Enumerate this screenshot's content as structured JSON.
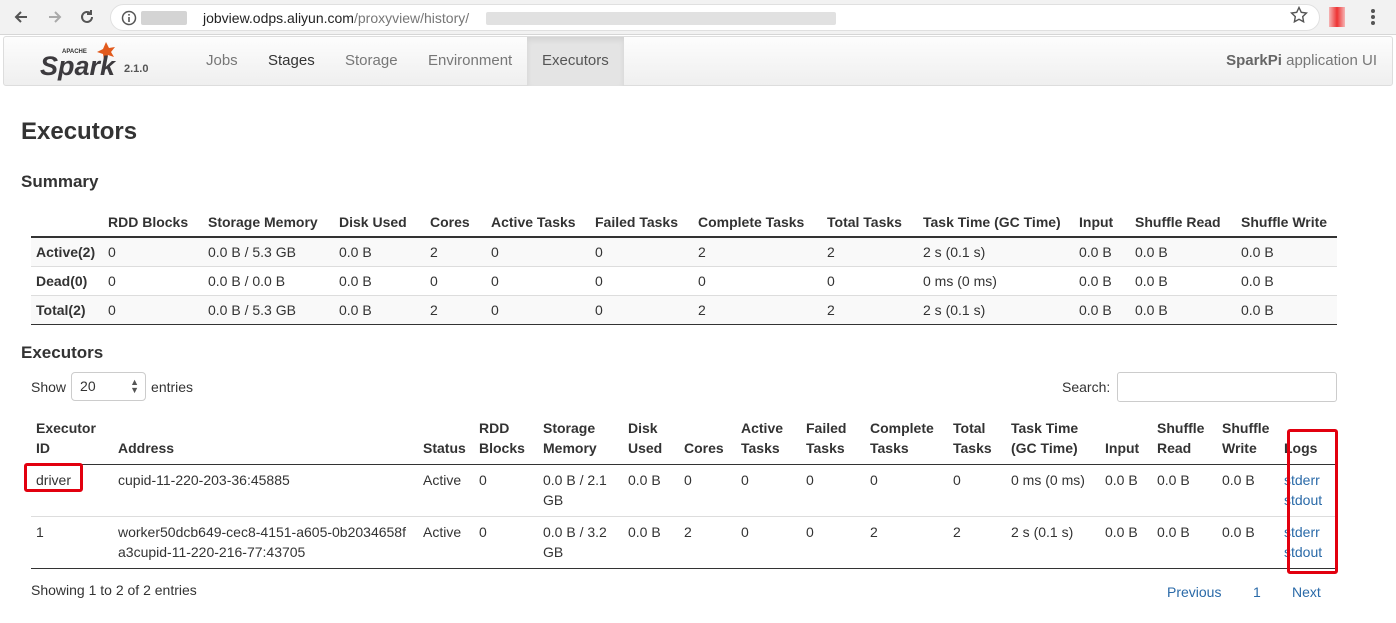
{
  "browser": {
    "url_host": "jobview.odps.aliyun.com",
    "url_path": "/proxyview/history/"
  },
  "nav": {
    "version": "2.1.0",
    "tabs": [
      {
        "label": "Jobs"
      },
      {
        "label": "Stages"
      },
      {
        "label": "Storage"
      },
      {
        "label": "Environment"
      },
      {
        "label": "Executors"
      }
    ],
    "app_name": "SparkPi",
    "app_suffix": " application UI"
  },
  "page": {
    "title": "Executors",
    "summary_title": "Summary",
    "executors_title": "Executors"
  },
  "summary": {
    "columns": [
      "",
      "RDD Blocks",
      "Storage Memory",
      "Disk Used",
      "Cores",
      "Active Tasks",
      "Failed Tasks",
      "Complete Tasks",
      "Total Tasks",
      "Task Time (GC Time)",
      "Input",
      "Shuffle Read",
      "Shuffle Write"
    ],
    "rows": [
      [
        "Active(2)",
        "0",
        "0.0 B / 5.3 GB",
        "0.0 B",
        "2",
        "0",
        "0",
        "2",
        "2",
        "2 s (0.1 s)",
        "0.0 B",
        "0.0 B",
        "0.0 B"
      ],
      [
        "Dead(0)",
        "0",
        "0.0 B / 0.0 B",
        "0.0 B",
        "0",
        "0",
        "0",
        "0",
        "0",
        "0 ms (0 ms)",
        "0.0 B",
        "0.0 B",
        "0.0 B"
      ],
      [
        "Total(2)",
        "0",
        "0.0 B / 5.3 GB",
        "0.0 B",
        "2",
        "0",
        "0",
        "2",
        "2",
        "2 s (0.1 s)",
        "0.0 B",
        "0.0 B",
        "0.0 B"
      ]
    ]
  },
  "controls": {
    "show_label": "Show",
    "entries_label": "entries",
    "page_size": "20",
    "search_label": "Search:"
  },
  "executors": {
    "columns": [
      "Executor ID",
      "Address",
      "Status",
      "RDD Blocks",
      "Storage Memory",
      "Disk Used",
      "Cores",
      "Active Tasks",
      "Failed Tasks",
      "Complete Tasks",
      "Total Tasks",
      "Task Time (GC Time)",
      "Input",
      "Shuffle Read",
      "Shuffle Write",
      "Logs"
    ],
    "rows": [
      {
        "id": "driver",
        "address": "cupid-11-220-203-36:45885",
        "status": "Active",
        "rdd": "0",
        "storage": "0.0 B / 2.1 GB",
        "disk": "0.0 B",
        "cores": "0",
        "active": "0",
        "failed": "0",
        "complete": "0",
        "total": "0",
        "time": "0 ms (0 ms)",
        "input": "0.0 B",
        "sread": "0.0 B",
        "swrite": "0.0 B",
        "log1": "stderr",
        "log2": "stdout"
      },
      {
        "id": "1",
        "address": "worker50dcb649-cec8-4151-a605-0b2034658fa3cupid-11-220-216-77:43705",
        "status": "Active",
        "rdd": "0",
        "storage": "0.0 B / 3.2 GB",
        "disk": "0.0 B",
        "cores": "2",
        "active": "0",
        "failed": "0",
        "complete": "2",
        "total": "2",
        "time": "2 s (0.1 s)",
        "input": "0.0 B",
        "sread": "0.0 B",
        "swrite": "0.0 B",
        "log1": "stderr",
        "log2": "stdout"
      }
    ]
  },
  "footer": {
    "info": "Showing 1 to 2 of 2 entries",
    "prev": "Previous",
    "page": "1",
    "next": "Next"
  }
}
